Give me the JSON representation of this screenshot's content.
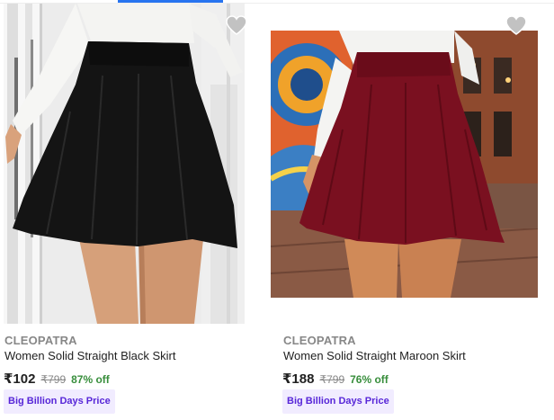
{
  "products": [
    {
      "brand": "CLEOPATRA",
      "title": "Women Solid Straight Black Skirt",
      "price": "₹102",
      "mrp": "₹799",
      "discount": "87% off",
      "badge": "Big Billion Days Price",
      "image_alt": "Woman in white top and black flared skirt",
      "wishlist_icon": "heart-icon"
    },
    {
      "brand": "CLEOPATRA",
      "title": "Women Solid Straight Maroon Skirt",
      "price": "₹188",
      "mrp": "₹799",
      "discount": "76% off",
      "badge": "Big Billion Days Price",
      "image_alt": "Woman in white top and maroon flared skirt on street",
      "wishlist_icon": "heart-icon"
    }
  ],
  "colors": {
    "accent": "#2874f0",
    "discount": "#388e3c",
    "badge_text": "#5726d8",
    "badge_bg": "#f1ecff",
    "brand_text": "#878787"
  }
}
